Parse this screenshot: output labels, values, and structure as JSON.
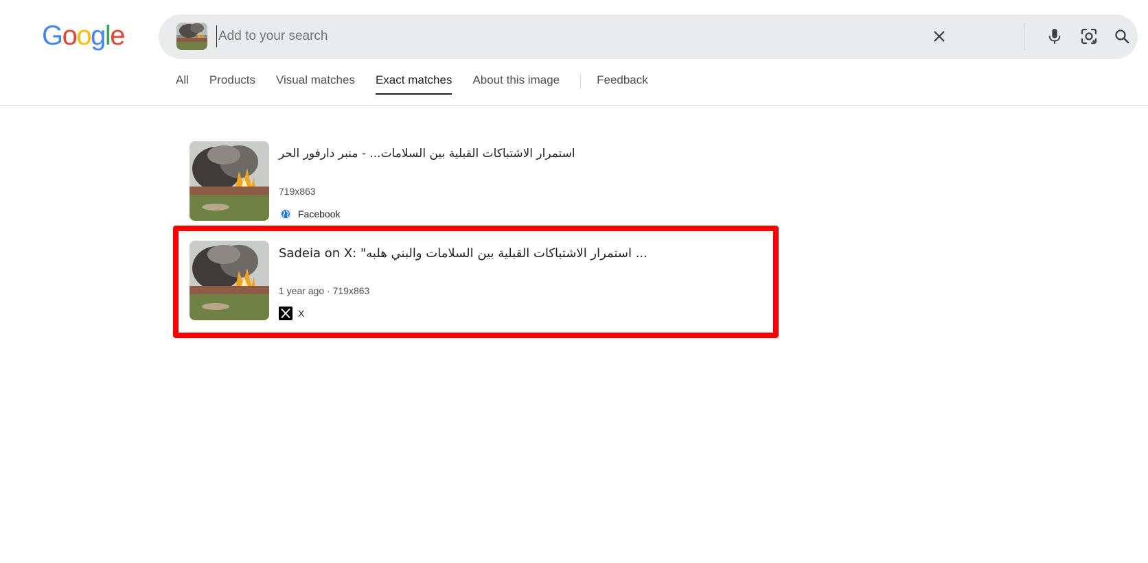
{
  "logo": {
    "letters": [
      "G",
      "o",
      "o",
      "g",
      "l",
      "e"
    ],
    "colors": [
      "#4285F4",
      "#EA4335",
      "#FBBC05",
      "#4285F4",
      "#34A853",
      "#EA4335"
    ]
  },
  "search": {
    "placeholder": "Add to your search",
    "value": "",
    "icons": [
      "clear-icon",
      "microphone-icon",
      "lens-camera-icon",
      "search-icon"
    ]
  },
  "tabs": [
    {
      "label": "All",
      "active": false
    },
    {
      "label": "Products",
      "active": false
    },
    {
      "label": "Visual matches",
      "active": false
    },
    {
      "label": "Exact matches",
      "active": true
    },
    {
      "label": "About this image",
      "active": false
    },
    {
      "label": "Feedback",
      "active": false
    }
  ],
  "results": [
    {
      "title": "استمرار الاشتباكات القبلية بين السلامات... - منبر دارفور الحر",
      "meta": "719x863",
      "source": "Facebook",
      "source_icon": "globe-icon"
    },
    {
      "title": "Sadeia on X: \"استمرار الاشتباكات القبلية بين السلامات والبني هلبه ...",
      "meta": "1 year ago · 719x863",
      "source": "X",
      "source_icon": "x-logo-icon"
    }
  ],
  "colors": {
    "highlight": "#ff0000",
    "searchbar_bg": "#eaebed"
  }
}
